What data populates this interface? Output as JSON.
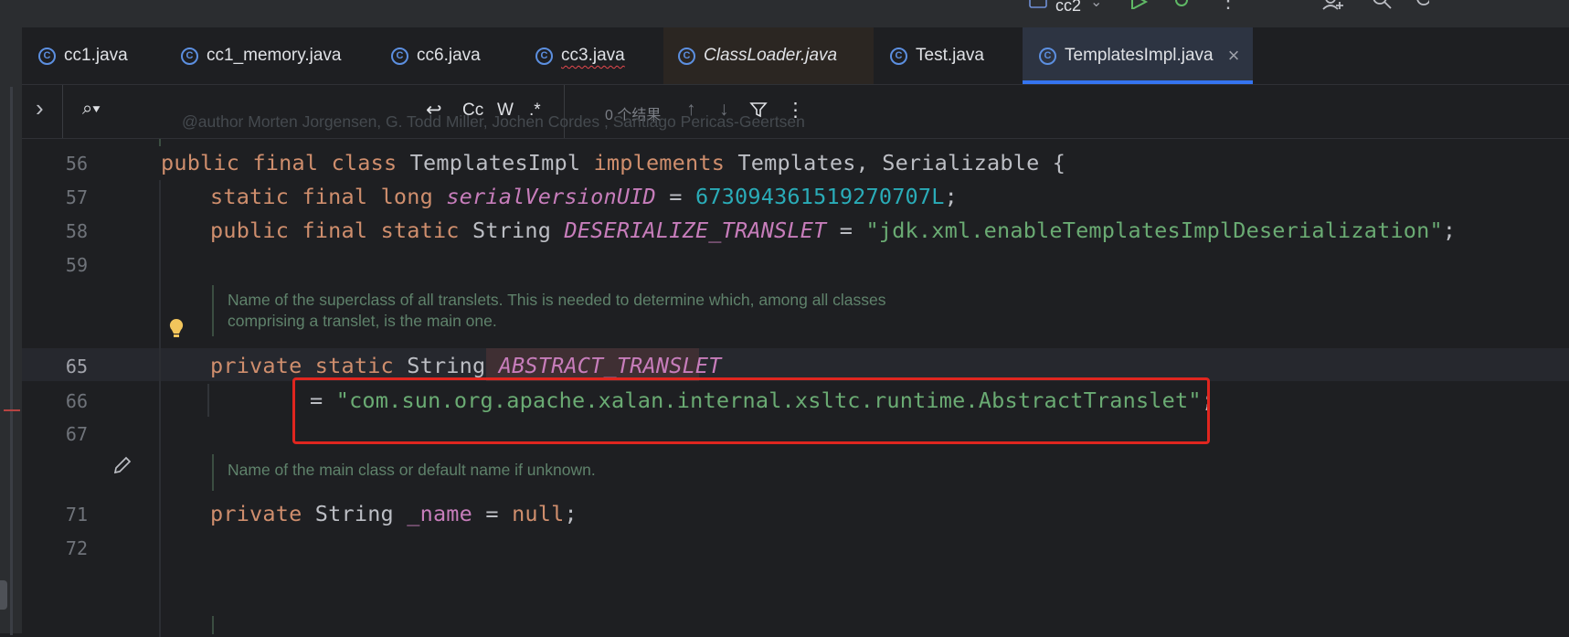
{
  "topbar": {
    "run_config": "cc2",
    "icons": [
      "folder-icon",
      "chevron-down-icon",
      "run-icon",
      "debug-icon",
      "more-icon",
      "add-user-icon",
      "search-icon",
      "settings-icon"
    ]
  },
  "tabs": [
    {
      "label": "cc1.java",
      "style": "normal"
    },
    {
      "label": "cc1_memory.java",
      "style": "normal"
    },
    {
      "label": "cc6.java",
      "style": "normal"
    },
    {
      "label": "cc3.java",
      "style": "error-underline"
    },
    {
      "label": "ClassLoader.java",
      "style": "italic"
    },
    {
      "label": "Test.java",
      "style": "normal"
    },
    {
      "label": "TemplatesImpl.java",
      "style": "active",
      "close": "×"
    }
  ],
  "findbar": {
    "expand_glyph": "›",
    "search_glyph": "⌕▾",
    "options": [
      "↩",
      "Cc",
      "W",
      ".*"
    ],
    "result_text": "0 个结果",
    "nav": [
      "↑",
      "↓"
    ],
    "filter_glyph": "⏷",
    "more_glyph": "⋮"
  },
  "editor": {
    "lines": [
      {
        "num": "56"
      },
      {
        "num": "57"
      },
      {
        "num": "58"
      },
      {
        "num": "59"
      },
      {
        "num": "65"
      },
      {
        "num": "66"
      },
      {
        "num": "67"
      },
      {
        "num": "71"
      },
      {
        "num": "72"
      }
    ],
    "code": {
      "l56": {
        "kw1": "public",
        "kw2": "final",
        "kw3": "class",
        "name": "TemplatesImpl",
        "kw4": "implements",
        "rest": "Templates, Serializable {"
      },
      "l57": {
        "kw1": "static",
        "kw2": "final",
        "kw3": "long",
        "field": "serialVersionUID",
        "eq": "=",
        "number": "673094361519270707L",
        "end": ";"
      },
      "l58": {
        "kw1": "public",
        "kw2": "final",
        "kw3": "static",
        "type": "String",
        "field": "DESERIALIZE_TRANSLET",
        "eq": "=",
        "string": "\"jdk.xml.enableTemplatesImplDeserialization\"",
        "end": ";"
      },
      "l65": {
        "kw1": "private",
        "kw2": "static",
        "type": "String",
        "field": "ABSTRACT_TRANSLET"
      },
      "l66": {
        "eq": "=",
        "string": "\"com.sun.org.apache.xalan.internal.xsltc.runtime.AbstractTranslet\"",
        "end": ";"
      },
      "l71": {
        "kw1": "private",
        "type": "String",
        "field": "_name",
        "eq": "=",
        "nullkw": "null",
        "end": ";"
      }
    },
    "doc1": [
      "Name of the superclass of all translets. This is needed to determine which, among all classes",
      "comprising a translet, is the main one."
    ],
    "doc2": "Name of the main class or default name if unknown.",
    "top_fragment": "@author Morten Jorgensen, G. Todd Miller, Jochen Cordes , Santiago Pericas-Geertsen"
  },
  "colors": {
    "keyword": "#cf8e6d",
    "field": "#c77dbb",
    "number": "#2aacb8",
    "string": "#6aab73",
    "highlight_box": "#e0261f",
    "accent": "#3574f0"
  }
}
